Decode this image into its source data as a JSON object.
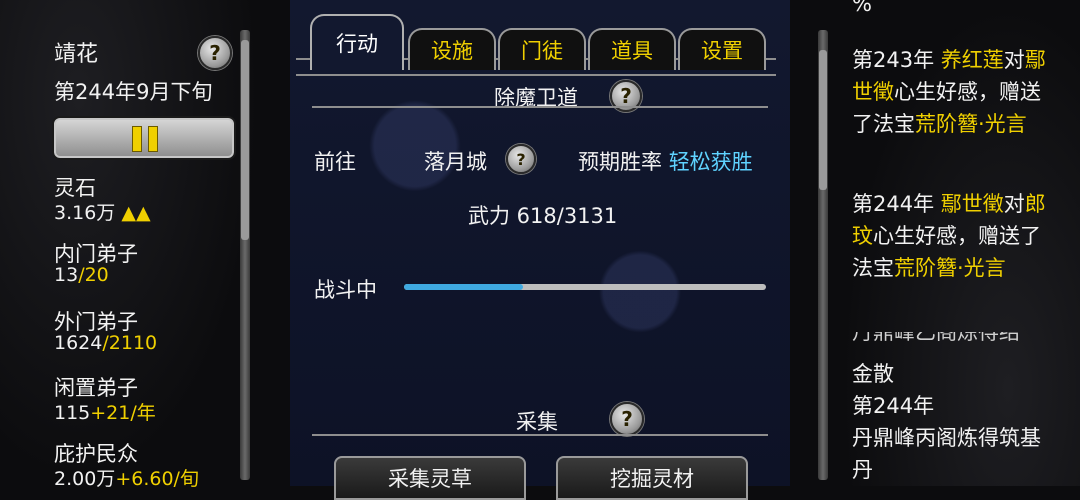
{
  "left": {
    "sect_name": "靖花",
    "date": "第244年9月下旬",
    "stats": [
      {
        "label": "灵石",
        "value": "3.16万",
        "extra": "▲▲"
      },
      {
        "label": "内门弟子",
        "value": "13",
        "extra": "/20"
      },
      {
        "label": "外门弟子",
        "value": "1624",
        "extra": "/2110"
      },
      {
        "label": "闲置弟子",
        "value": "115",
        "extra": "+21/年"
      },
      {
        "label": "庇护民众",
        "value": "2.00万",
        "extra": "+6.60/旬"
      }
    ]
  },
  "tabs": [
    "行动",
    "设施",
    "门徒",
    "道具",
    "设置"
  ],
  "center": {
    "section_title": "除魔卫道",
    "goto_label": "前往",
    "location": "落月城",
    "win_rate_label": "预期胜率",
    "win_rate_value": "轻松获胜",
    "force": "武力 618/3131",
    "battle_label": "战斗中",
    "progress": 0.33,
    "gather_title": "采集",
    "gather_btn": "采集灵草",
    "dig_btn": "挖掘灵材"
  },
  "log": {
    "partial_top": "%",
    "entries": [
      {
        "year": "第243年",
        "a": "养红莲",
        "mid1": "对",
        "b": "鄢世徵",
        "mid2": "心生好感，赠送了法宝",
        "item": "荒阶簪·光言"
      },
      {
        "year": "第244年",
        "a": "鄢世徵",
        "mid1": "对",
        "b": "郎玟",
        "mid2": "心生好感，赠送了法宝",
        "item": "荒阶簪·光言"
      }
    ],
    "clipped": "丹鼎峰乙阁炼得结",
    "tail1": "金散",
    "year3": "第244年",
    "tail2": "丹鼎峰丙阁炼得筑基丹"
  }
}
